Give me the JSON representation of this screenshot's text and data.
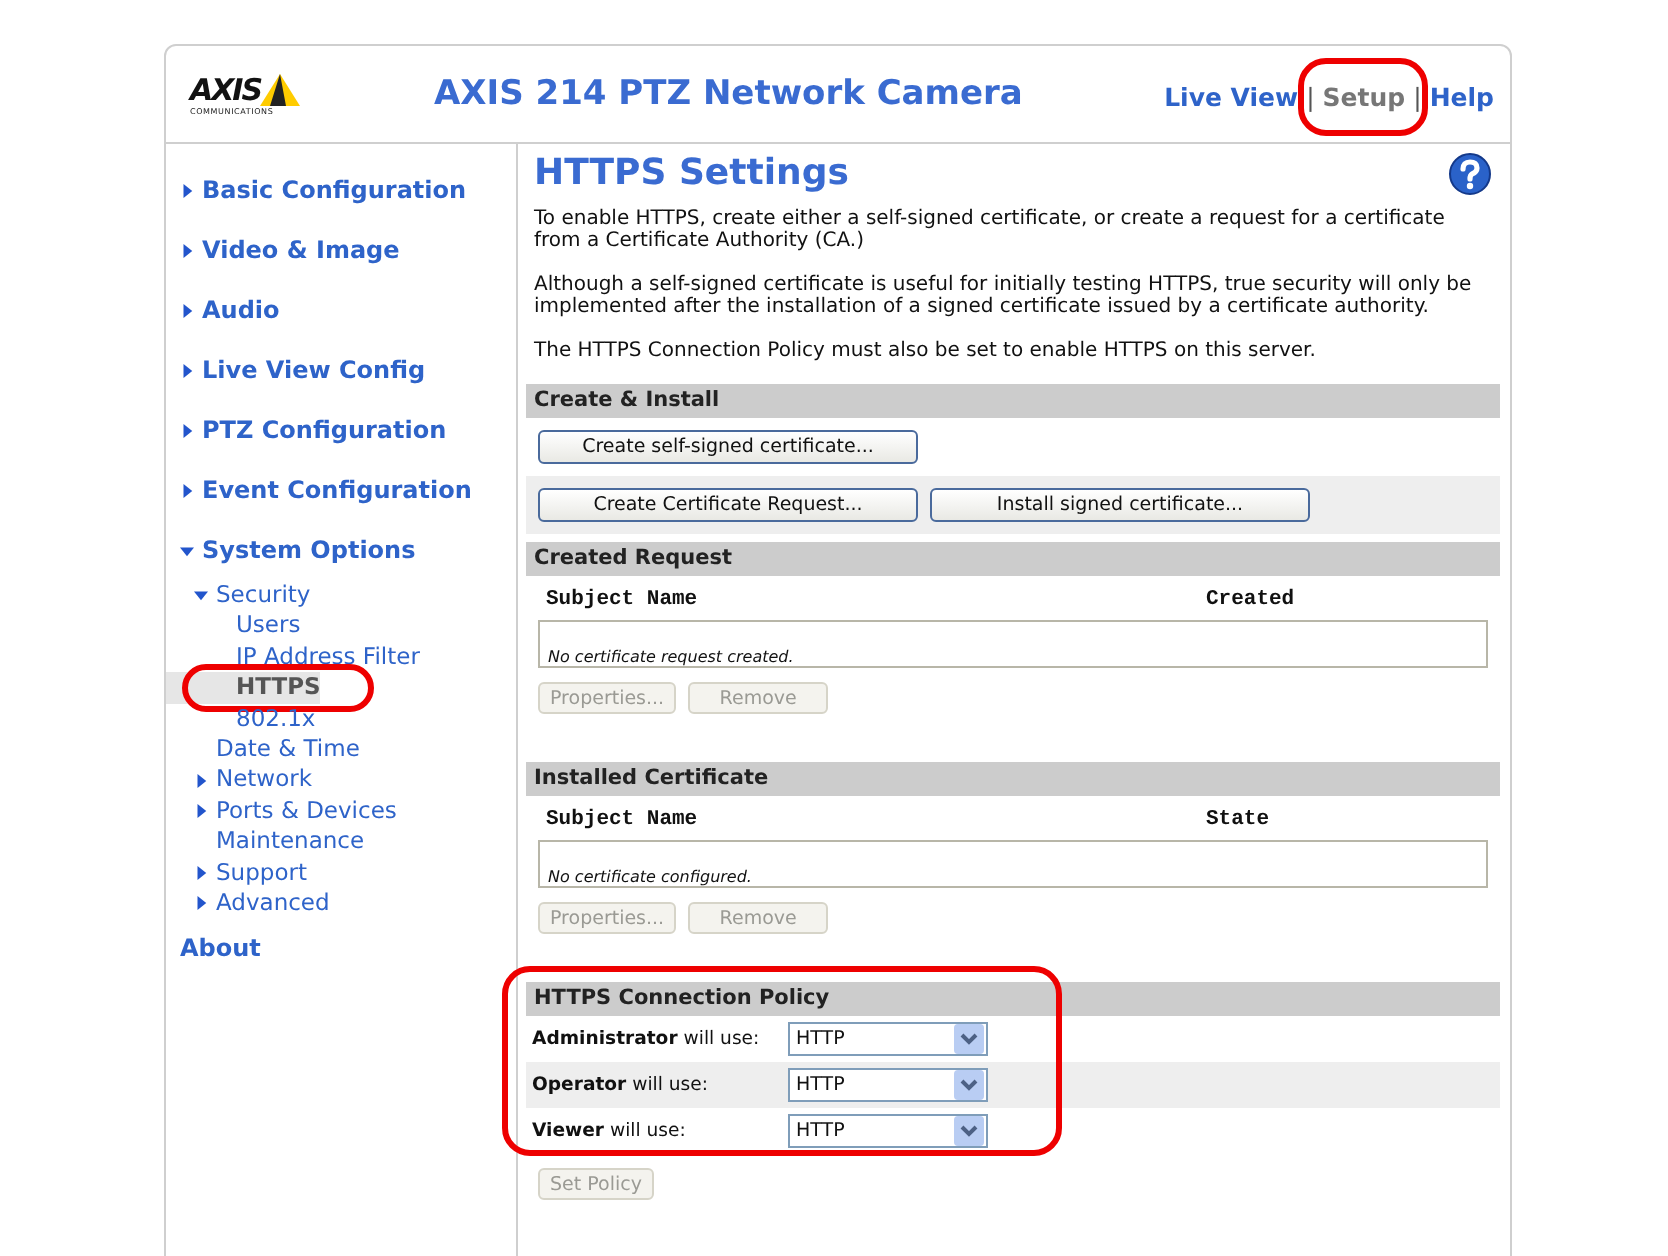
{
  "header": {
    "logo_text": "AXIS",
    "logo_subtext": "COMMUNICATIONS",
    "title": "AXIS 214 PTZ Network Camera",
    "links": [
      {
        "label": "Live View",
        "separator_after": "|",
        "selected": false
      },
      {
        "label": "Setup",
        "separator_after": "|",
        "selected": true,
        "highlighted": true
      },
      {
        "label": "Help",
        "selected": false
      }
    ]
  },
  "sidebar": {
    "items": [
      {
        "label": "Basic Configuration",
        "expanded": false,
        "selected": false
      },
      {
        "label": "Video & Image",
        "expanded": false,
        "selected": false
      },
      {
        "label": "Audio",
        "expanded": false,
        "selected": false
      },
      {
        "label": "Live View Config",
        "expanded": false,
        "selected": false
      },
      {
        "label": "PTZ Configuration",
        "expanded": false,
        "selected": false
      },
      {
        "label": "Event Configuration",
        "expanded": false,
        "selected": false
      },
      {
        "label": "System Options",
        "expanded": true,
        "selected": false,
        "children": [
          {
            "label": "Security",
            "expanded": true,
            "selected": false,
            "children": [
              {
                "label": "Users",
                "selected": false
              },
              {
                "label": "IP Address Filter",
                "selected": false
              },
              {
                "label": "HTTPS",
                "selected": true,
                "highlighted": true
              },
              {
                "label": "802.1x",
                "selected": false
              }
            ]
          },
          {
            "label": "Date & Time",
            "selected": false
          },
          {
            "label": "Network",
            "expanded": false,
            "selected": false
          },
          {
            "label": "Ports & Devices",
            "expanded": false,
            "selected": false
          },
          {
            "label": "Maintenance",
            "selected": false
          },
          {
            "label": "Support",
            "expanded": false,
            "selected": false
          },
          {
            "label": "Advanced",
            "expanded": false,
            "selected": false
          }
        ]
      },
      {
        "label": "About",
        "selected": false
      }
    ]
  },
  "content": {
    "title": "HTTPS Settings",
    "paragraphs": [
      "To enable HTTPS, create either a self-signed certificate, or create a request for a certificate from a Certificate Authority (CA.)",
      "Although a self-signed certificate is useful for initially testing HTTPS, true security will only be implemented after the installation of a signed certificate issued by a certificate authority.",
      "The HTTPS Connection Policy must also be set to enable HTTPS on this server."
    ],
    "sections": [
      {
        "kind": "actions",
        "title": "Create & Install",
        "rows": [
          [
            {
              "label": "Create self-signed certificate...",
              "disabled": false
            }
          ],
          [
            {
              "label": "Create Certificate Request...",
              "disabled": false
            },
            {
              "label": "Install signed certificate...",
              "disabled": false
            }
          ]
        ]
      },
      {
        "kind": "table",
        "title": "Created Request",
        "columns": [
          "Subject Name",
          "Created"
        ],
        "empty_text": "No certificate request created.",
        "buttons": [
          {
            "label": "Properties...",
            "disabled": true
          },
          {
            "label": "Remove",
            "disabled": true
          }
        ]
      },
      {
        "kind": "table",
        "title": "Installed Certificate",
        "columns": [
          "Subject Name",
          "State"
        ],
        "empty_text": "No certificate configured.",
        "buttons": [
          {
            "label": "Properties...",
            "disabled": true
          },
          {
            "label": "Remove",
            "disabled": true
          }
        ]
      },
      {
        "kind": "policy",
        "title": "HTTPS Connection Policy",
        "highlighted": true,
        "rows": [
          {
            "label": "**Administrator** will use:",
            "value": "HTTP"
          },
          {
            "label": "**Operator** will use:",
            "value": "HTTP"
          },
          {
            "label": "**Viewer** will use:",
            "value": "HTTP"
          }
        ],
        "button": {
          "label": "Set Policy",
          "disabled": true
        }
      }
    ]
  }
}
